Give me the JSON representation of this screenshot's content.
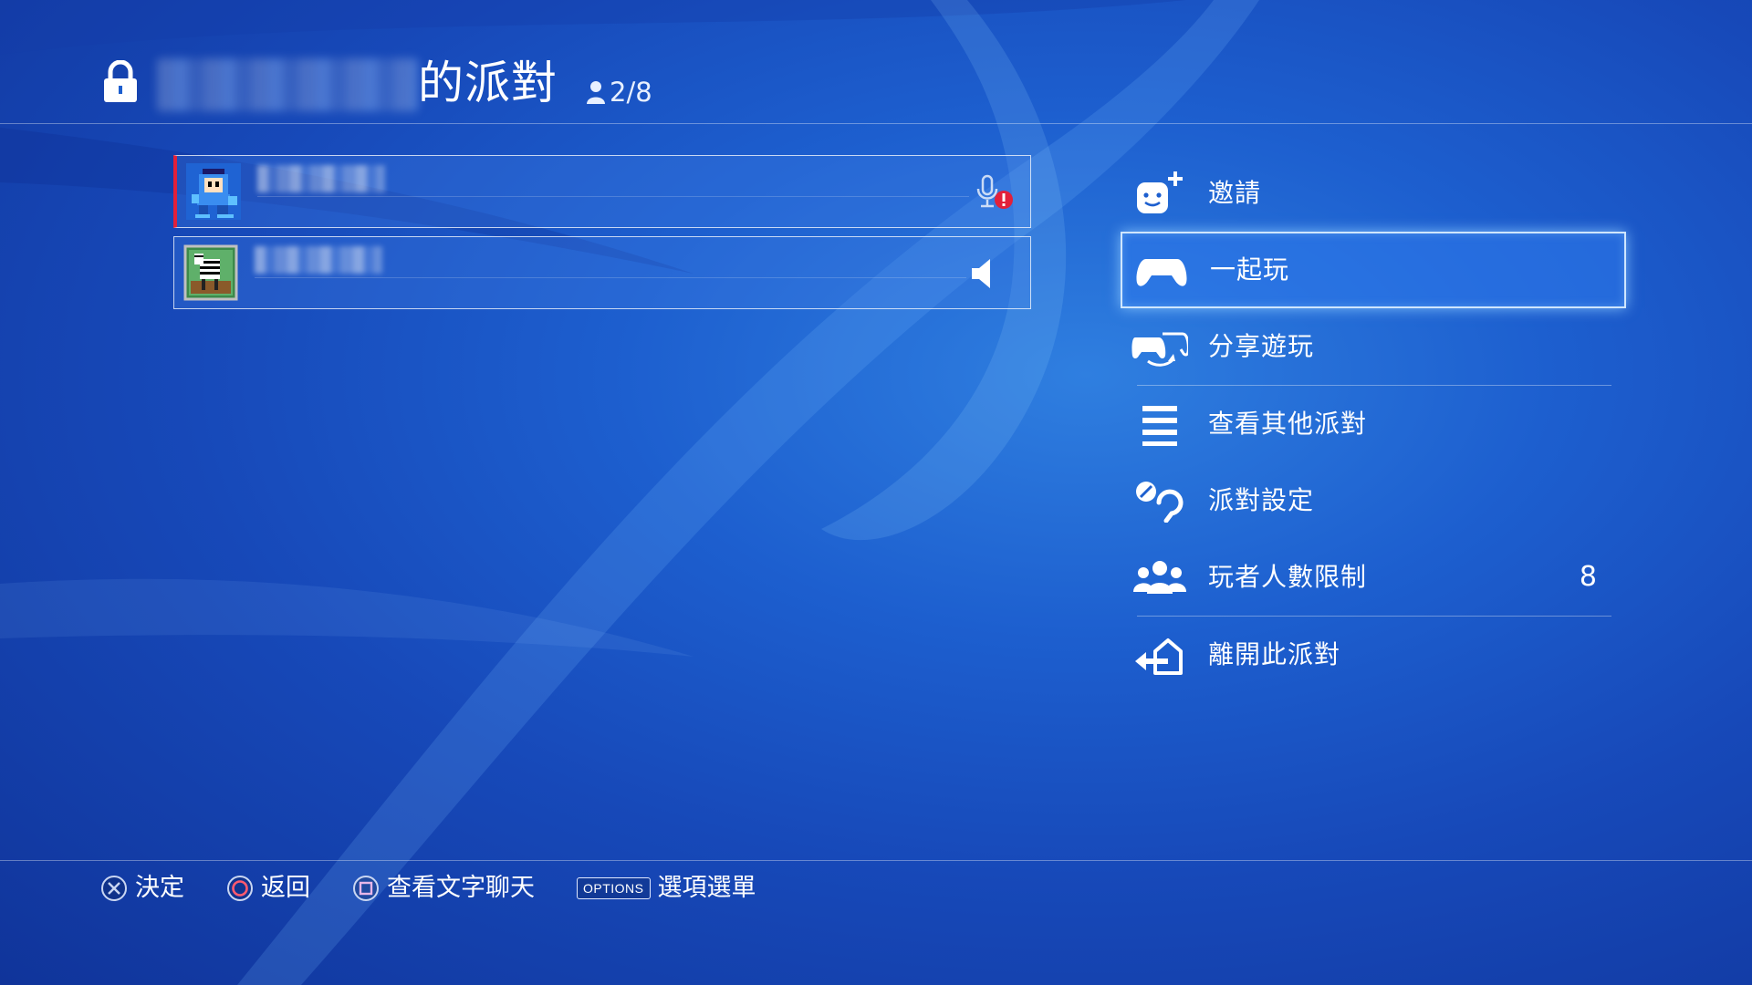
{
  "header": {
    "title": "的派對",
    "member_count": "2/8"
  },
  "members": [
    {
      "avatar": "mega-man-avatar",
      "status_icon": "mic-muted-warning-icon",
      "active": true
    },
    {
      "avatar": "zebra-avatar",
      "status_icon": "speaker-icon",
      "active": false
    }
  ],
  "menu": {
    "items": [
      {
        "id": "invite",
        "label": "邀請",
        "icon": "invite-friend-icon"
      },
      {
        "id": "play-together",
        "label": "一起玩",
        "icon": "controller-icon",
        "selected": true
      },
      {
        "id": "share-play",
        "label": "分享遊玩",
        "icon": "share-play-icon"
      },
      {
        "id": "view-other-parties",
        "label": "查看其他派對",
        "icon": "list-icon"
      },
      {
        "id": "party-settings",
        "label": "派對設定",
        "icon": "party-settings-icon"
      },
      {
        "id": "player-limit",
        "label": "玩者人數限制",
        "icon": "group-icon",
        "value": "8"
      },
      {
        "id": "leave-party",
        "label": "離開此派對",
        "icon": "leave-icon"
      }
    ]
  },
  "footer": {
    "confirm": "決定",
    "back": "返回",
    "text_chat": "查看文字聊天",
    "options_badge": "OPTIONS",
    "options_menu": "選項選單"
  },
  "colors": {
    "background": "#1b55c6",
    "active_member_bar": "#e2203a",
    "mic_warning": "#e2203a",
    "circle_button": "#ff5a6e"
  }
}
